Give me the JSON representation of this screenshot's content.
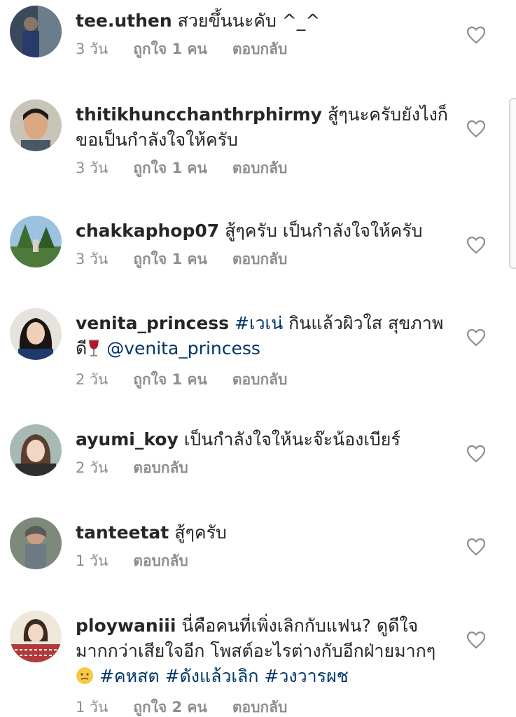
{
  "comments": [
    {
      "username": "tee.uthen",
      "text": "สวยขึ้นนะคับ ^_^",
      "time": "3 วัน",
      "likes": "ถูกใจ 1 คน",
      "reply": "ตอบกลับ"
    },
    {
      "username": "thitikhuncchanthrphirmy",
      "text": "สู้ๆนะครับยังไงก็ขอเป็นกำลังใจให้ครับ",
      "time": "3 วัน",
      "likes": "ถูกใจ 1 คน",
      "reply": "ตอบกลับ"
    },
    {
      "username": "chakkaphop07",
      "text": "สู้ๆครับ เป็นกำลังใจให้ครับ",
      "time": "3 วัน",
      "likes": "ถูกใจ 1 คน",
      "reply": "ตอบกลับ"
    },
    {
      "username": "venita_princess",
      "hashtag": "#เวเน่",
      "text_a": "กินแล้วผิวใส สุขภาพดี",
      "emoji": "wine-glass",
      "mention": "@venita_princess",
      "time": "2 วัน",
      "likes": "ถูกใจ 1 คน",
      "reply": "ตอบกลับ"
    },
    {
      "username": "ayumi_koy",
      "text": "เป็นกำลังใจให้นะจ๊ะน้องเบียร์",
      "time": "2 วัน",
      "reply": "ตอบกลับ"
    },
    {
      "username": "tanteetat",
      "text": "สู้ๆครับ",
      "time": "1 วัน",
      "reply": "ตอบกลับ"
    },
    {
      "username": "ploywaniii",
      "text": "นี่คือคนที่เพิ่งเลิกกับแฟน? ดูดีใจมากกว่าเสียใจอีก โพสต์อะไรต่างกับอีกฝ่ายมากๆ",
      "emoji": "confused-face",
      "hashtags": [
        "#คหสต",
        "#ดังแล้วเลิก",
        "#วงวารผช"
      ],
      "time": "1 วัน",
      "likes": "ถูกใจ 2 คน",
      "reply": "ตอบกลับ"
    }
  ],
  "colors": {
    "text": "#262626",
    "meta": "#8e8e8e",
    "link": "#003569",
    "heart_stroke": "#8e8e8e"
  }
}
